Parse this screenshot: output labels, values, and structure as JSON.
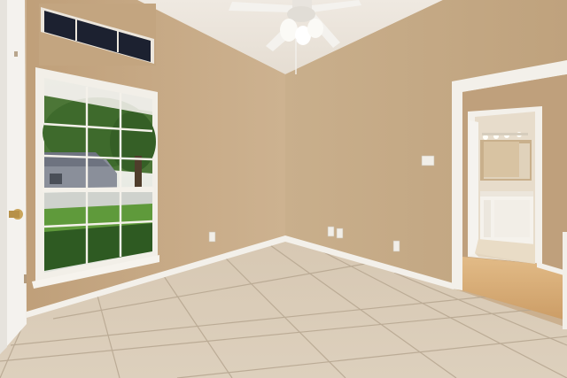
{
  "scene": {
    "subject": "empty-bedroom-interior",
    "palette": {
      "wall_left": "#c7a985",
      "wall_back": "#c4aa86",
      "ceiling": "#ece6de",
      "floor_tile": "#d9cbb7",
      "grout": "#b9aa95",
      "trim": "#f3f0ea",
      "hall_floor": "#d8ad78",
      "sky": "#eef0ea",
      "foliage": "#3f6a2c"
    }
  }
}
